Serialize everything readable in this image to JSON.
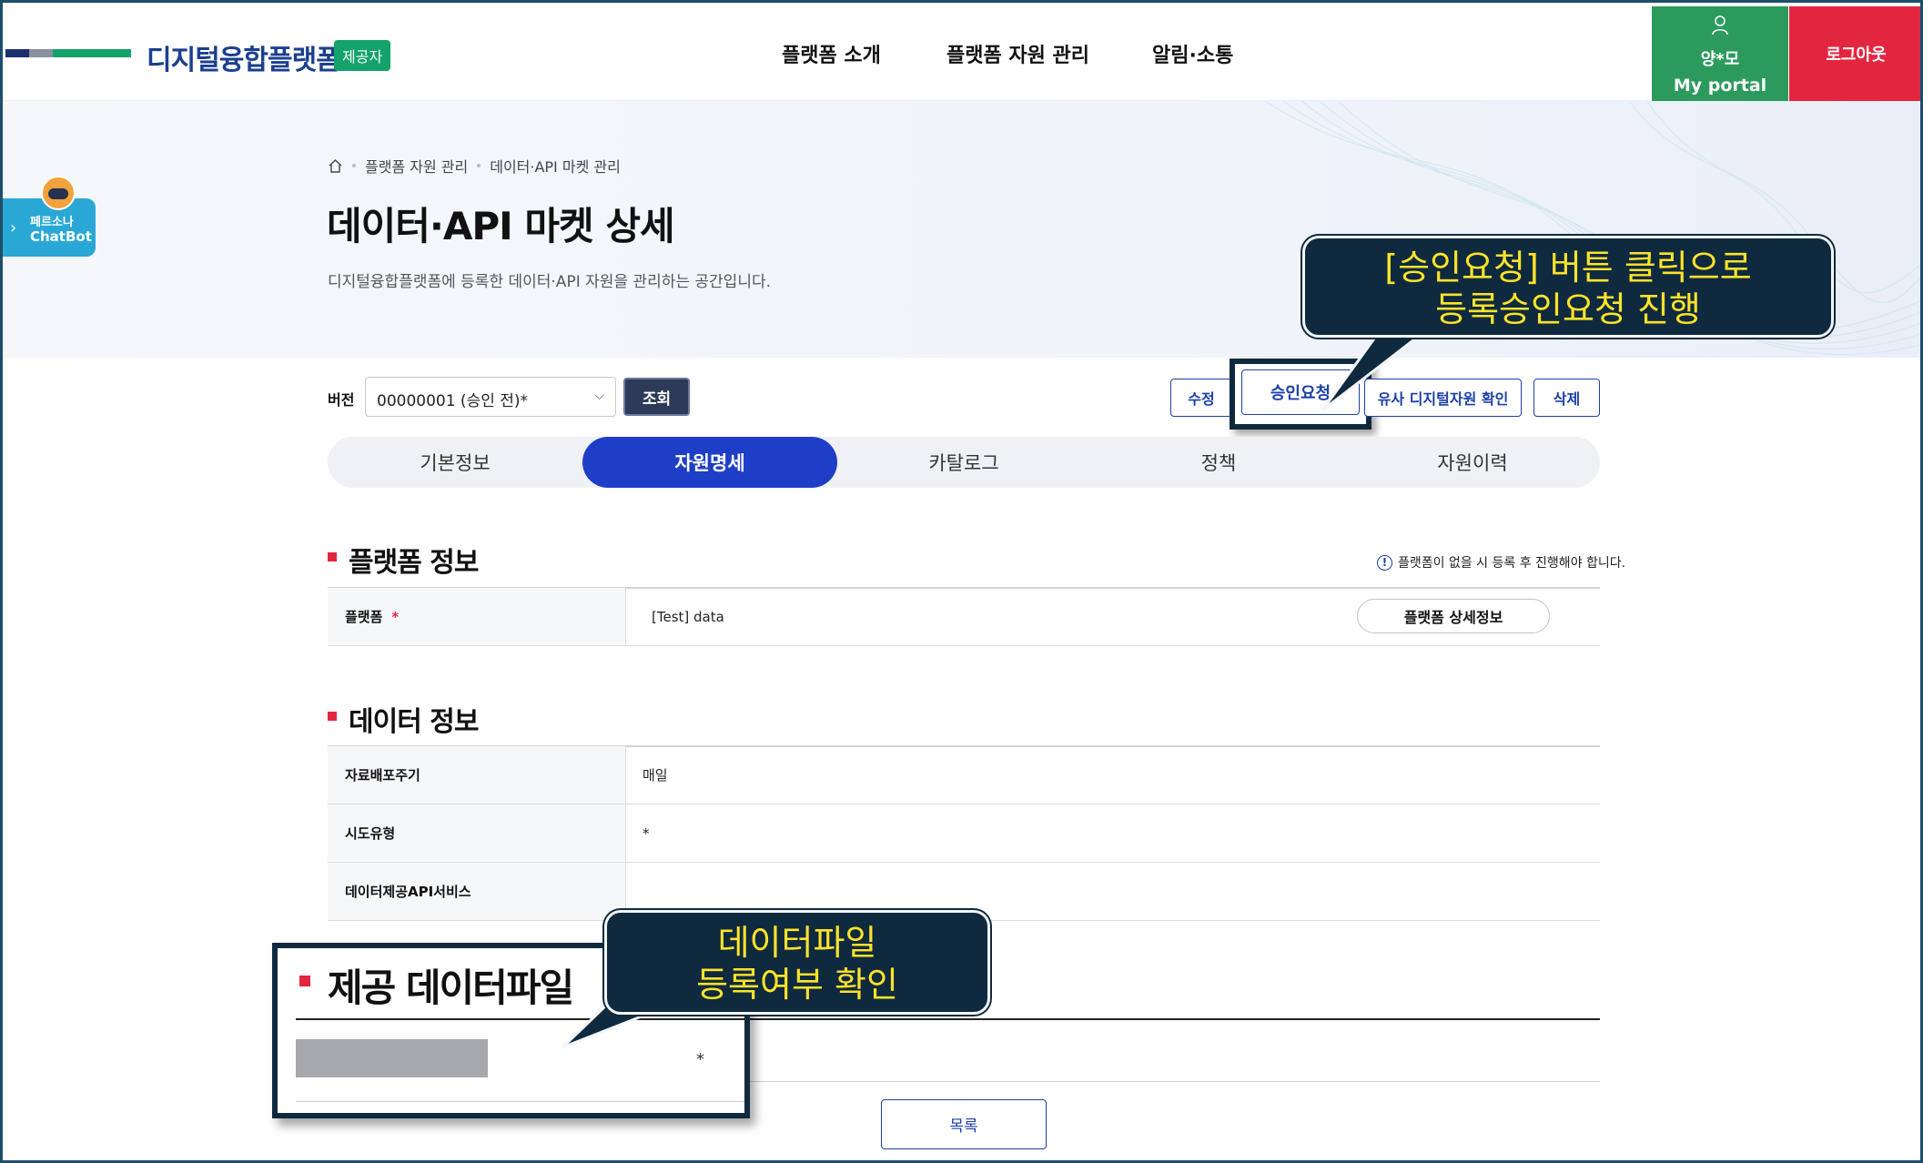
{
  "header": {
    "logo_text": "디지털융합플랫폼",
    "logo_badge": "제공자",
    "nav": [
      "플랫폼 소개",
      "플랫폼 자원 관리",
      "알림·소통"
    ],
    "user_name": "양*모",
    "portal_label": "My portal",
    "logout_label": "로그아웃"
  },
  "chatbot": {
    "line1": "페르소나",
    "line2": "ChatBot"
  },
  "breadcrumb": [
    "플랫폼 자원 관리",
    "데이터·API 마켓 관리"
  ],
  "page": {
    "title": "데이터·API 마켓 상세",
    "description": "디지털융합플랫폼에 등록한 데이터·API 자원을 관리하는 공간입니다."
  },
  "version": {
    "label": "버전",
    "selected": "00000001 (승인 전)*",
    "search_label": "조회"
  },
  "actions": {
    "edit": "수정",
    "approve_request": "승인요청",
    "similar": "유사 디지털자원 확인",
    "delete": "삭제"
  },
  "tabs": [
    {
      "label": "기본정보",
      "active": false
    },
    {
      "label": "자원명세",
      "active": true
    },
    {
      "label": "카탈로그",
      "active": false
    },
    {
      "label": "정책",
      "active": false
    },
    {
      "label": "자원이력",
      "active": false
    }
  ],
  "platform_section": {
    "title": "플랫폼 정보",
    "note": "플랫폼이 없을 시 등록 후 진행해야 합니다.",
    "row_label": "플랫폼",
    "required_mark": "*",
    "row_value": "[Test] data",
    "detail_button": "플랫폼 상세정보"
  },
  "data_section": {
    "title": "데이터 정보",
    "rows": [
      {
        "label": "자료배포주기",
        "value": "매일"
      },
      {
        "label": "시도유형",
        "value": "*"
      },
      {
        "label": "데이터제공API서비스",
        "value": ""
      }
    ]
  },
  "file_section": {
    "title": "제공 데이터파일",
    "star": "*"
  },
  "list_button": "목록",
  "annotations": {
    "approve": [
      "[승인요청] 버튼 클릭으로",
      "등록승인요청 진행"
    ],
    "file": [
      "데이터파일",
      "등록여부 확인"
    ]
  },
  "colors": {
    "brand_blue": "#1c3f8e",
    "active_tab": "#1f3ec7",
    "portal_green": "#2c9a5c",
    "logout_red": "#e3263f",
    "callout_bg": "#0f2a3f",
    "callout_text": "#ffe32a"
  }
}
